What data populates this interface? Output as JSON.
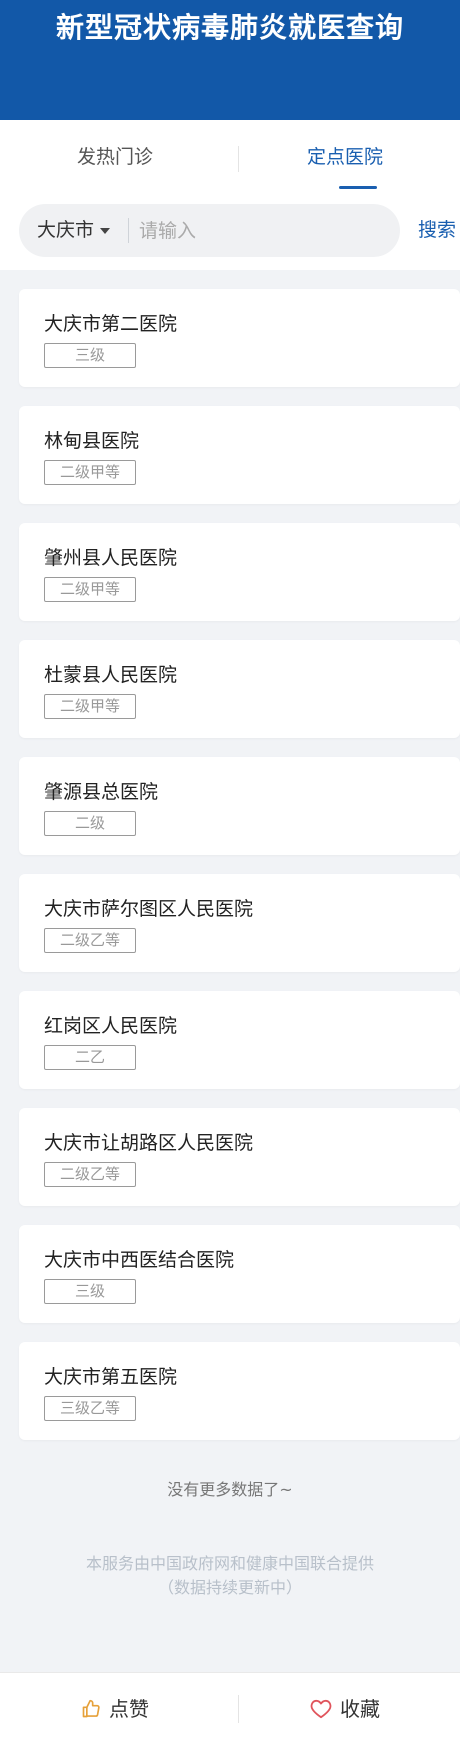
{
  "header": {
    "title": "新型冠状病毒肺炎就医查询"
  },
  "tabs": [
    {
      "label": "发热门诊"
    },
    {
      "label": "定点医院"
    }
  ],
  "search": {
    "city": "大庆市",
    "placeholder": "请输入",
    "button_label": "搜索"
  },
  "hospitals": [
    {
      "name": "大庆市第二医院",
      "level": "三级"
    },
    {
      "name": "林甸县医院",
      "level": "二级甲等"
    },
    {
      "name": "肇州县人民医院",
      "level": "二级甲等"
    },
    {
      "name": "杜蒙县人民医院",
      "level": "二级甲等"
    },
    {
      "name": "肇源县总医院",
      "level": "二级"
    },
    {
      "name": "大庆市萨尔图区人民医院",
      "level": "二级乙等"
    },
    {
      "name": "红岗区人民医院",
      "level": "二乙"
    },
    {
      "name": "大庆市让胡路区人民医院",
      "level": "二级乙等"
    },
    {
      "name": "大庆市中西医结合医院",
      "level": "三级"
    },
    {
      "name": "大庆市第五医院",
      "level": "三级乙等"
    }
  ],
  "status": {
    "no_more": "没有更多数据了~"
  },
  "footer": {
    "line1": "本服务由中国政府网和健康中国联合提供",
    "line2": "（数据持续更新中）"
  },
  "bottom_bar": {
    "like_label": "点赞",
    "collect_label": "收藏"
  },
  "icons": {
    "like": "thumbs-up-icon",
    "collect": "heart-icon",
    "city_dropdown": "caret-down-icon"
  },
  "colors": {
    "brand": "#1258a8",
    "accent": "#1a5fb0",
    "like_icon": "#e6a13a",
    "collect_icon": "#e0545c"
  }
}
